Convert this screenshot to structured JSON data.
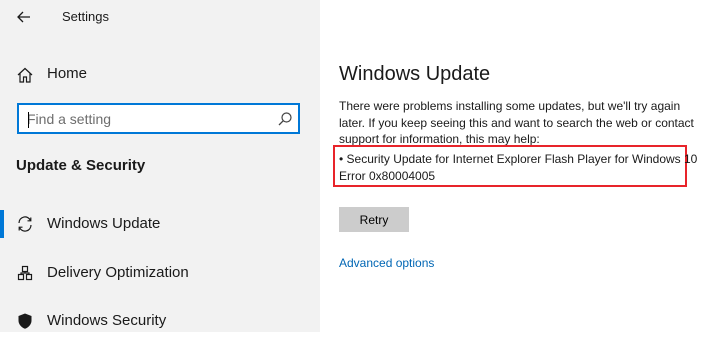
{
  "header": {
    "back_icon": "back-arrow-icon",
    "title": "Settings"
  },
  "sidebar": {
    "home": {
      "icon": "home-icon",
      "label": "Home"
    },
    "search": {
      "placeholder": "Find a setting",
      "icon": "search-icon"
    },
    "section_title": "Update & Security",
    "items": [
      {
        "icon": "sync-icon",
        "label": "Windows Update",
        "active": true
      },
      {
        "icon": "delivery-optimization-icon",
        "label": "Delivery Optimization",
        "active": false
      },
      {
        "icon": "shield-icon",
        "label": "Windows Security",
        "active": false
      }
    ]
  },
  "main": {
    "title": "Windows Update",
    "message_lines": [
      "There were problems installing some updates, but we'll try again",
      "later. If you keep seeing this and want to search the web or contact",
      "support for information, this may help:"
    ],
    "error_lines": [
      "• Security Update for Internet Explorer Flash Player for Windows 10",
      "Error 0x80004005"
    ],
    "retry_label": "Retry",
    "advanced_options_label": "Advanced options"
  },
  "colors": {
    "accent": "#0078d7",
    "error_highlight": "#e8242a",
    "link": "#0066b4",
    "sidebar_bg": "#f2f2f2",
    "button_bg": "#cccccc"
  }
}
